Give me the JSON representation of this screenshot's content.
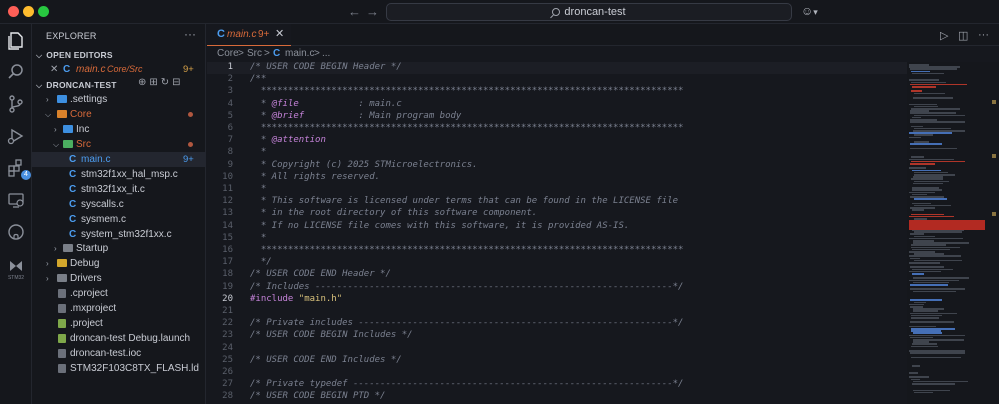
{
  "titlebar": {
    "search_text": "droncan-test",
    "back_arrow": "←",
    "forward_arrow": "→",
    "copilot_glyph": "☺",
    "copilot_chevron": "▾"
  },
  "activity_bar": {
    "items": [
      {
        "name": "explorer-icon"
      },
      {
        "name": "search-icon"
      },
      {
        "name": "source-control-icon"
      },
      {
        "name": "run-debug-icon"
      },
      {
        "name": "extensions-icon",
        "badge": "4"
      },
      {
        "name": "remote-explorer-icon"
      },
      {
        "name": "github-icon"
      },
      {
        "name": "stm32-icon",
        "label": "STM32"
      }
    ]
  },
  "sidebar": {
    "title": "EXPLORER",
    "more": "···",
    "open_editors_label": "OPEN EDITORS",
    "open_editor": {
      "close": "✕",
      "name": "main.c",
      "path": "Core/Src",
      "count": "9+"
    },
    "workspace_label": "DRONCAN-TEST",
    "tree": [
      {
        "label": ".settings"
      },
      {
        "label": "Core"
      },
      {
        "label": "Inc"
      },
      {
        "label": "Src"
      },
      {
        "label": "main.c",
        "count": "9+"
      },
      {
        "label": "stm32f1xx_hal_msp.c"
      },
      {
        "label": "stm32f1xx_it.c"
      },
      {
        "label": "syscalls.c"
      },
      {
        "label": "sysmem.c"
      },
      {
        "label": "system_stm32f1xx.c"
      },
      {
        "label": "Startup"
      },
      {
        "label": "Debug"
      },
      {
        "label": "Drivers"
      },
      {
        "label": ".cproject"
      },
      {
        "label": ".mxproject"
      },
      {
        "label": ".project"
      },
      {
        "label": "droncan-test Debug.launch"
      },
      {
        "label": "droncan-test.ioc"
      },
      {
        "label": "STM32F103C8TX_FLASH.ld"
      }
    ]
  },
  "tab": {
    "name": "main.c",
    "count": "9+",
    "close": "✕"
  },
  "tab_actions": {
    "run": "▷",
    "split": "◫",
    "more": "···"
  },
  "breadcrumb": {
    "part1": "Core",
    "sep": ">",
    "part2": "Src",
    "part3": "main.c",
    "part4": "..."
  },
  "editor": {
    "lines": [
      {
        "n": "1",
        "text": "/* USER CODE BEGIN Header */"
      },
      {
        "n": "2",
        "text": "/**"
      },
      {
        "n": "3",
        "text": "  ******************************************************************************"
      },
      {
        "n": "4",
        "pre": "  * ",
        "tag": "@file",
        "post": "           : main.c"
      },
      {
        "n": "5",
        "pre": "  * ",
        "tag": "@brief",
        "post": "          : Main program body"
      },
      {
        "n": "6",
        "text": "  ******************************************************************************"
      },
      {
        "n": "7",
        "pre": "  * ",
        "tag": "@attention",
        "post": ""
      },
      {
        "n": "8",
        "text": "  *"
      },
      {
        "n": "9",
        "text": "  * Copyright (c) 2025 STMicroelectronics."
      },
      {
        "n": "10",
        "text": "  * All rights reserved."
      },
      {
        "n": "11",
        "text": "  *"
      },
      {
        "n": "12",
        "text": "  * This software is licensed under terms that can be found in the LICENSE file"
      },
      {
        "n": "13",
        "text": "  * in the root directory of this software component."
      },
      {
        "n": "14",
        "text": "  * If no LICENSE file comes with this software, it is provided AS-IS."
      },
      {
        "n": "15",
        "text": "  *"
      },
      {
        "n": "16",
        "text": "  ******************************************************************************"
      },
      {
        "n": "17",
        "text": "  */"
      },
      {
        "n": "18",
        "text": "/* USER CODE END Header */"
      },
      {
        "n": "19",
        "text": "/* Includes ------------------------------------------------------------------*/"
      },
      {
        "n": "20",
        "kw": "#include",
        "str": " \"main.h\""
      },
      {
        "n": "21",
        "text": ""
      },
      {
        "n": "22",
        "text": "/* Private includes ----------------------------------------------------------*/"
      },
      {
        "n": "23",
        "text": "/* USER CODE BEGIN Includes */"
      },
      {
        "n": "24",
        "text": ""
      },
      {
        "n": "25",
        "text": "/* USER CODE END Includes */"
      },
      {
        "n": "26",
        "text": ""
      },
      {
        "n": "27",
        "text": "/* Private typedef -----------------------------------------------------------*/"
      },
      {
        "n": "28",
        "text": "/* USER CODE BEGIN PTD */"
      }
    ]
  }
}
